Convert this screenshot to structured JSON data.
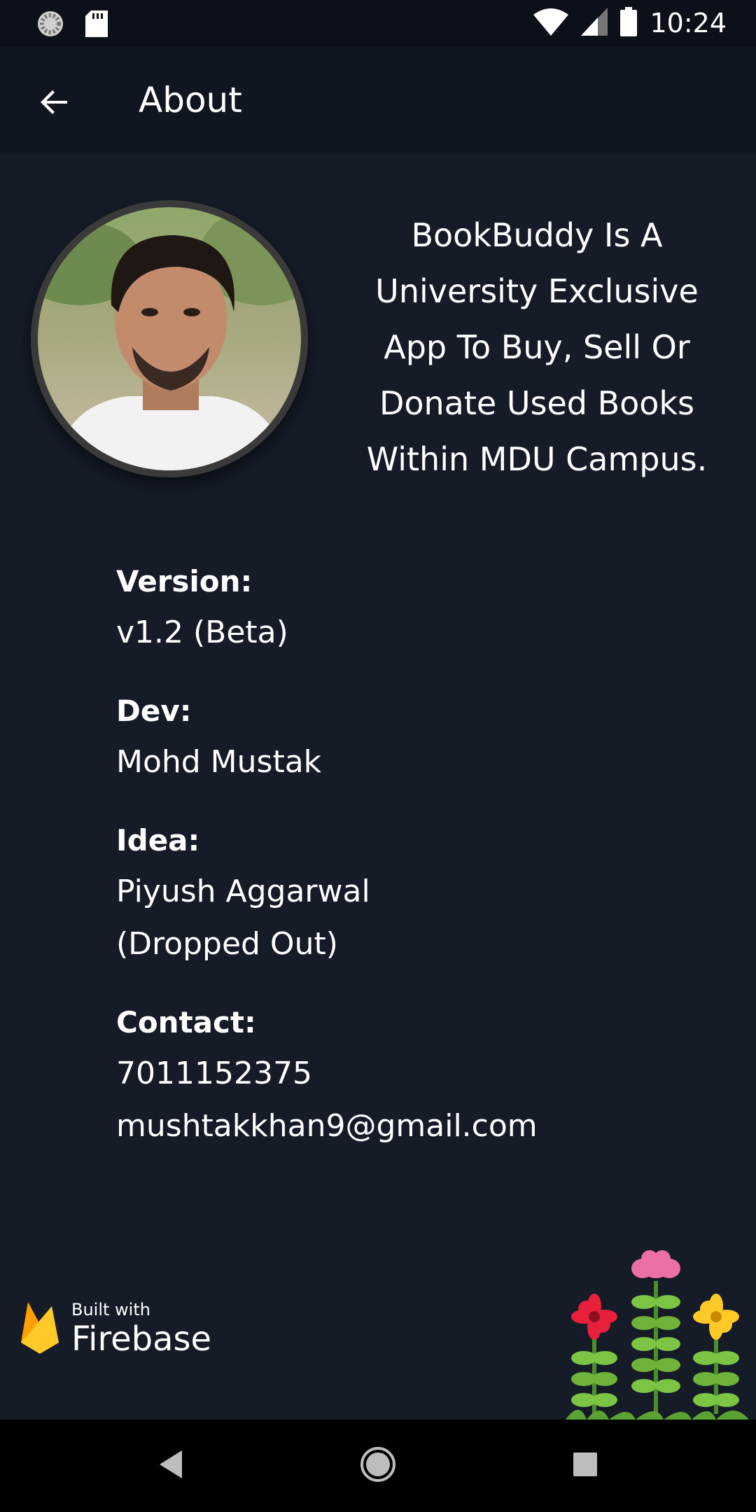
{
  "status_bar": {
    "time": "10:24",
    "left_icons": [
      "sync-icon",
      "sd-card-icon"
    ],
    "right_icons": [
      "wifi-icon",
      "cell-signal-icon",
      "battery-icon"
    ]
  },
  "app_bar": {
    "title": "About",
    "back_icon": "arrow-back-icon"
  },
  "about": {
    "description": "BookBuddy Is A University Exclusive App To Buy, Sell Or Donate Used Books Within MDU Campus."
  },
  "info": {
    "version_label": "Version:",
    "version_value": "v1.2 (Beta)",
    "dev_label": "Dev:",
    "dev_value": "Mohd Mustak",
    "idea_label": "Idea:",
    "idea_value_1": "Piyush Aggarwal",
    "idea_value_2": "(Dropped Out)",
    "contact_label": "Contact:",
    "contact_phone": "7011152375",
    "contact_email": "mushtakkhan9@gmail.com"
  },
  "firebase_badge": {
    "small": "Built with",
    "big": "Firebase"
  },
  "nav_bar": {
    "icons": [
      "nav-back-icon",
      "nav-home-icon",
      "nav-recents-icon"
    ]
  },
  "colors": {
    "background": "#151c28",
    "app_bar": "#101620",
    "status_bar": "#0c1119",
    "text": "#ffffff"
  }
}
